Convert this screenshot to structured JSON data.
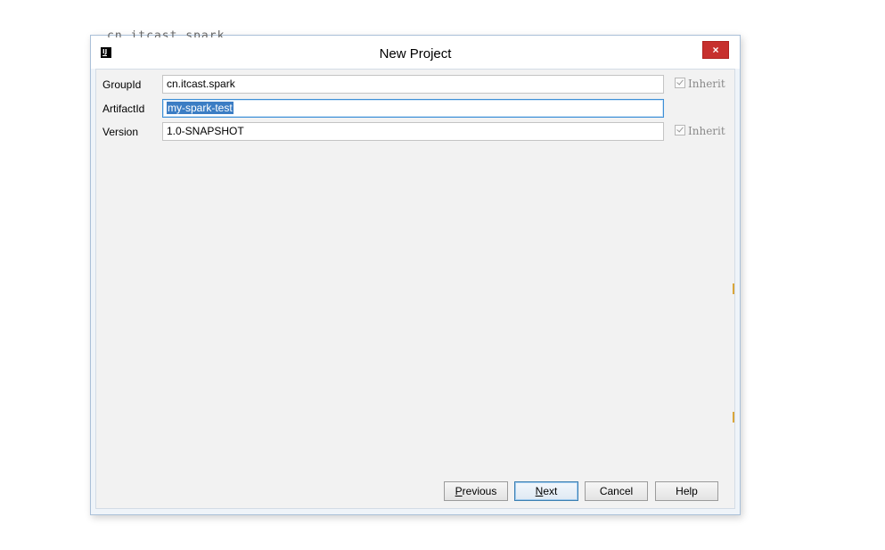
{
  "window": {
    "title": "New Project",
    "background_text": "cn.itcast.spark",
    "close_symbol": "×"
  },
  "form": {
    "group_id": {
      "label": "GroupId",
      "value": "cn.itcast.spark",
      "inherit_label": "Inherit",
      "inherit_checked": true
    },
    "artifact_id": {
      "label": "ArtifactId",
      "value": "my-spark-test"
    },
    "version": {
      "label": "Version",
      "value": "1.0-SNAPSHOT",
      "inherit_label": "Inherit",
      "inherit_checked": true
    }
  },
  "buttons": {
    "previous_mnemonic": "P",
    "previous_rest": "revious",
    "next_mnemonic": "N",
    "next_rest": "ext",
    "cancel": "Cancel",
    "help": "Help"
  },
  "colors": {
    "close_button": "#c7302e",
    "selection": "#3b7dc4",
    "focus_border": "#3d8fd6"
  }
}
